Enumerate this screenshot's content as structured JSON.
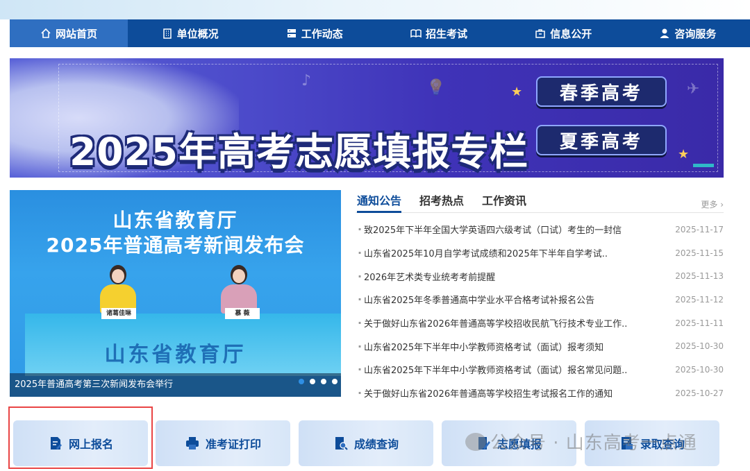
{
  "nav": {
    "items": [
      {
        "label": "网站首页",
        "icon": "home-icon",
        "active": true
      },
      {
        "label": "单位概况",
        "icon": "building-icon"
      },
      {
        "label": "工作动态",
        "icon": "server-icon"
      },
      {
        "label": "招生考试",
        "icon": "book-icon"
      },
      {
        "label": "信息公开",
        "icon": "briefcase-icon"
      },
      {
        "label": "咨询服务",
        "icon": "user-icon"
      }
    ]
  },
  "banner": {
    "title": "2025年高考志愿填报专栏",
    "btn_spring": "春季高考",
    "btn_summer": "夏季高考"
  },
  "carousel": {
    "title_line1": "山东省教育厅",
    "title_line2": "2025年普通高考新闻发布会",
    "desk_text": "山东省教育厅",
    "caption": "2025年普通高考第三次新闻发布会举行",
    "nameplate_left": "诸葛佳琳",
    "nameplate_right": "慕 薇",
    "slides": 4,
    "active_slide": 0
  },
  "news": {
    "tabs": [
      "通知公告",
      "招考热点",
      "工作资讯"
    ],
    "more": "更多",
    "items": [
      {
        "title": "致2025年下半年全国大学英语四六级考试（口试）考生的一封信",
        "date": "2025-11-17"
      },
      {
        "title": "山东省2025年10月自学考试成绩和2025年下半年自学考试..",
        "date": "2025-11-15"
      },
      {
        "title": "2026年艺术类专业统考考前提醒",
        "date": "2025-11-13"
      },
      {
        "title": "山东省2025年冬季普通高中学业水平合格考试补报名公告",
        "date": "2025-11-12"
      },
      {
        "title": "关于做好山东省2026年普通高等学校招收民航飞行技术专业工作..",
        "date": "2025-11-11"
      },
      {
        "title": "山东省2025年下半年中小学教师资格考试（面试）报考须知",
        "date": "2025-10-30"
      },
      {
        "title": "山东省2025年下半年中小学教师资格考试（面试）报名常见问题..",
        "date": "2025-10-30"
      },
      {
        "title": "关于做好山东省2026年普通高等学校招生考试报名工作的通知",
        "date": "2025-10-27"
      }
    ]
  },
  "quick": {
    "items": [
      {
        "label": "网上报名",
        "icon": "edit-doc-icon"
      },
      {
        "label": "准考证打印",
        "icon": "printer-icon"
      },
      {
        "label": "成绩查询",
        "icon": "search-doc-icon"
      },
      {
        "label": "志愿填报",
        "icon": "pen-doc-icon"
      },
      {
        "label": "录取查询",
        "icon": "admission-doc-icon"
      }
    ]
  },
  "watermark": "公众号 · 山东高考一点通",
  "colors": {
    "nav_bg": "#0d4c9a",
    "nav_active": "#2f6fc1",
    "highlight": "#e94444"
  }
}
